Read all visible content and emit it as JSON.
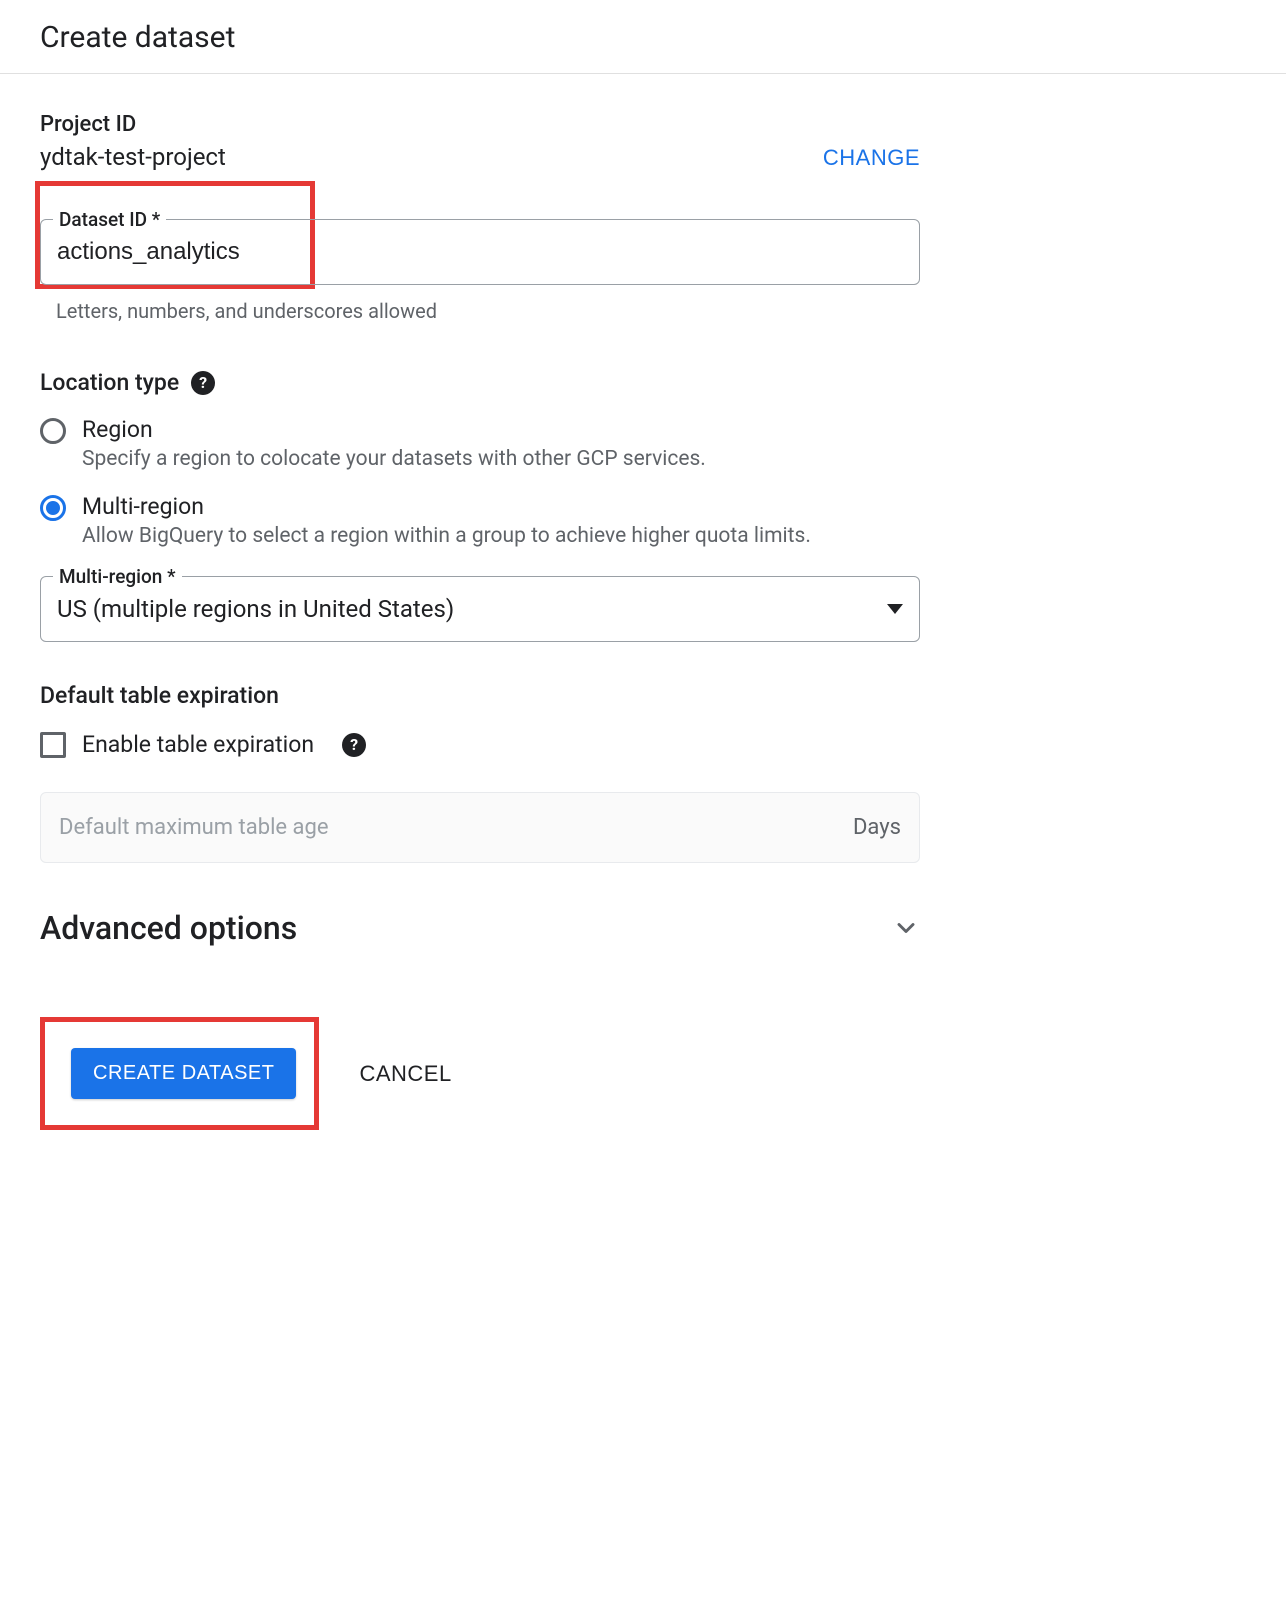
{
  "page": {
    "title": "Create dataset"
  },
  "project": {
    "label": "Project ID",
    "value": "ydtak-test-project",
    "change_label": "CHANGE"
  },
  "dataset": {
    "label": "Dataset ID *",
    "value": "actions_analytics",
    "helper": "Letters, numbers, and underscores allowed"
  },
  "location": {
    "heading": "Location type",
    "region": {
      "label": "Region",
      "desc": "Specify a region to colocate your datasets with other GCP services."
    },
    "multi": {
      "label": "Multi-region",
      "desc": "Allow BigQuery to select a region within a group to achieve higher quota limits."
    },
    "select_label": "Multi-region *",
    "select_value": "US (multiple regions in United States)"
  },
  "expiration": {
    "heading": "Default table expiration",
    "checkbox_label": "Enable table expiration",
    "placeholder": "Default maximum table age",
    "suffix": "Days"
  },
  "advanced": {
    "heading": "Advanced options"
  },
  "actions": {
    "create": "CREATE DATASET",
    "cancel": "CANCEL"
  }
}
